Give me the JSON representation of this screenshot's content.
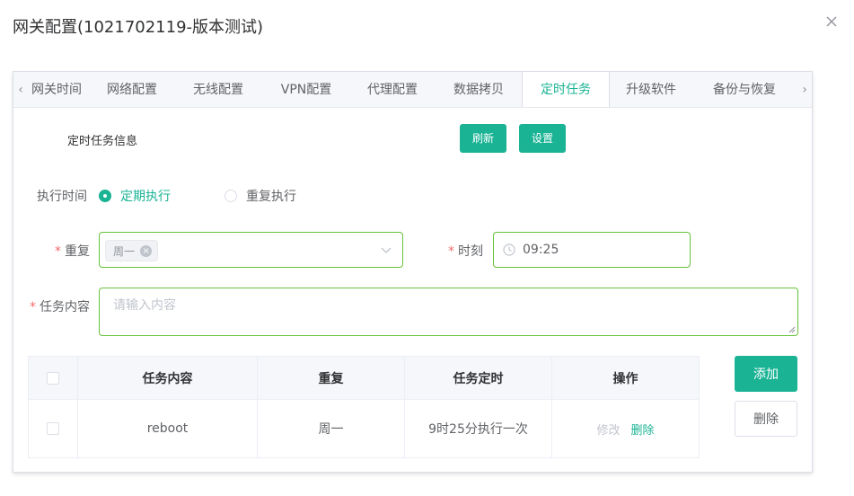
{
  "dialog": {
    "title": "网关配置(1021702119-版本测试)"
  },
  "tabs": [
    {
      "label": "网关时间"
    },
    {
      "label": "网络配置"
    },
    {
      "label": "无线配置"
    },
    {
      "label": "VPN配置"
    },
    {
      "label": "代理配置"
    },
    {
      "label": "数据拷贝"
    },
    {
      "label": "定时任务",
      "active": true
    },
    {
      "label": "升级软件"
    },
    {
      "label": "备份与恢复"
    }
  ],
  "section": {
    "label": "定时任务信息",
    "refresh_label": "刷新",
    "settings_label": "设置"
  },
  "form": {
    "exec_time_label": "执行时间",
    "exec_options": [
      "定期执行",
      "重复执行"
    ],
    "exec_selected": "定期执行",
    "repeat_label": "重复",
    "repeat_value": "周一",
    "time_label": "时刻",
    "time_value": "09:25",
    "content_label": "任务内容",
    "content_placeholder": "请输入内容"
  },
  "table": {
    "headers": [
      "任务内容",
      "重复",
      "任务定时",
      "操作"
    ],
    "rows": [
      {
        "content": "reboot",
        "repeat": "周一",
        "schedule": "9时25分执行一次",
        "edit": "修改",
        "delete": "删除"
      }
    ]
  },
  "actions": {
    "add_label": "添加",
    "delete_label": "删除"
  },
  "colors": {
    "accent": "#1ab394",
    "valid_border": "#67c23a",
    "required": "#f56c6c"
  }
}
